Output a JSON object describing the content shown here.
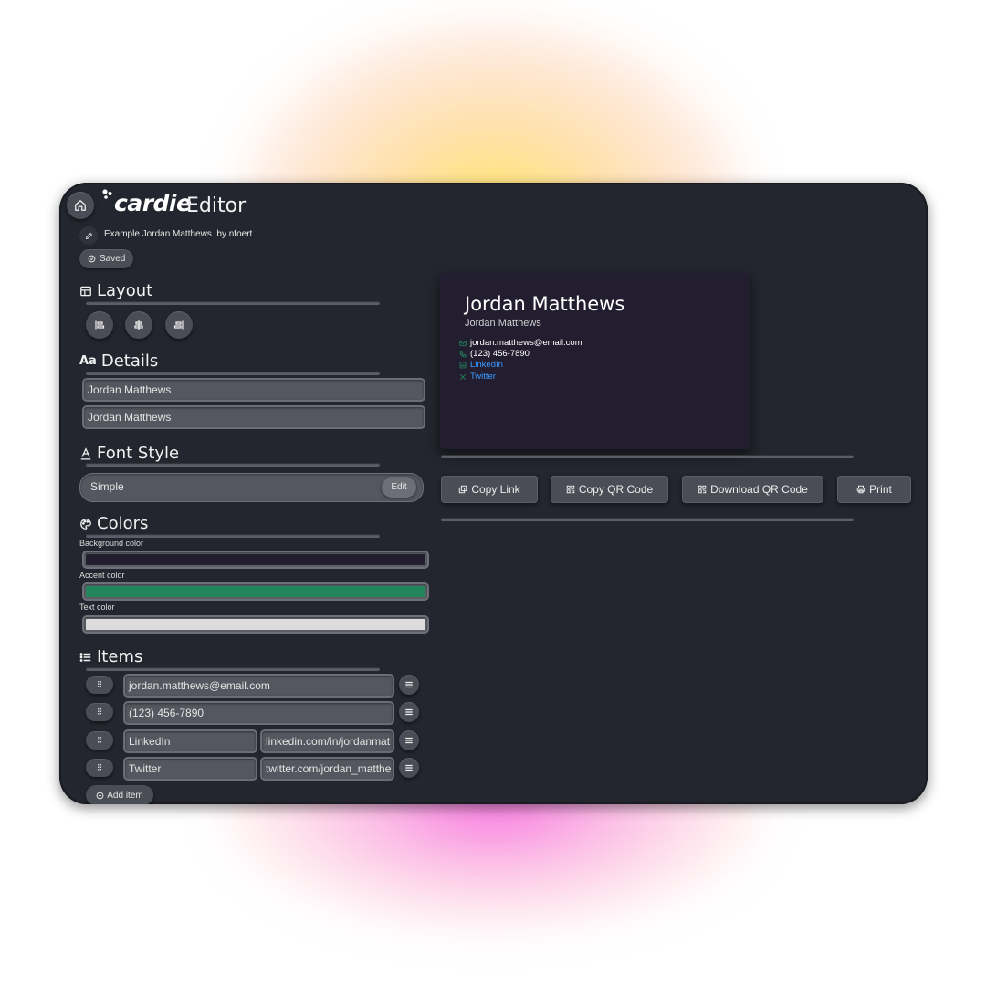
{
  "app": {
    "logo_text": "cardie",
    "title": "Editor"
  },
  "document": {
    "name": "Example Jordan Matthews",
    "author": "by nfoert",
    "saved_label": "Saved"
  },
  "sections": {
    "layout": "Layout",
    "details": "Details",
    "font_style": "Font Style",
    "colors": "Colors",
    "items": "Items"
  },
  "layout_options": [
    "align-left-icon",
    "align-center-icon",
    "align-right-icon"
  ],
  "details": {
    "name": "Jordan Matthews",
    "title": "Jordan Matthews"
  },
  "font_style": {
    "name": "Simple",
    "edit_label": "Edit"
  },
  "colors": {
    "background_label": "Background color",
    "background": "#221d2f",
    "accent_label": "Accent color",
    "accent": "#23855c",
    "text_label": "Text color",
    "text": "#dcdcdc"
  },
  "items": [
    {
      "icon": "email-icon",
      "value": "jordan.matthews@email.com"
    },
    {
      "icon": "phone-icon",
      "value": "(123) 456-7890"
    },
    {
      "icon": "linkedin-icon",
      "label": "LinkedIn",
      "value": "linkedin.com/in/jordanmat"
    },
    {
      "icon": "x-icon",
      "label": "Twitter",
      "value": "twitter.com/jordan_matthe"
    }
  ],
  "add_item_label": "Add item",
  "card": {
    "name": "Jordan Matthews",
    "title": "Jordan Matthews",
    "email": "jordan.matthews@email.com",
    "phone": "(123) 456-7890",
    "linkedin": "LinkedIn",
    "twitter": "Twitter",
    "link_color": "#3b9bff"
  },
  "actions": {
    "copy_link": "Copy Link",
    "copy_qr": "Copy QR Code",
    "download_qr": "Download QR Code",
    "print": "Print"
  }
}
